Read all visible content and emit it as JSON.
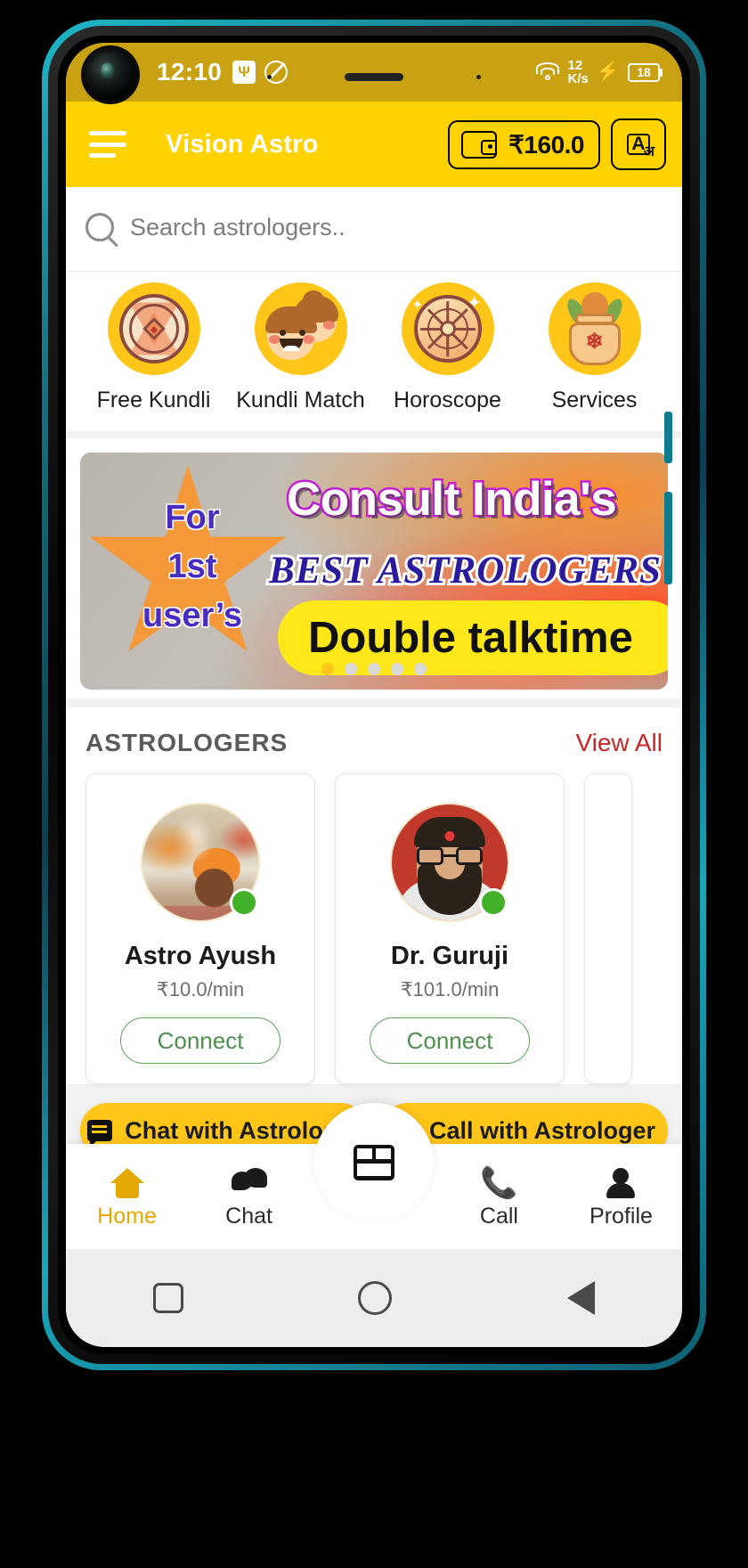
{
  "status_bar": {
    "time": "12:10",
    "usb_icon": "usb-icon",
    "mute_icon": "mute-icon",
    "wifi_icon": "wifi-icon",
    "net_speed_value": "12",
    "net_speed_unit": "K/s",
    "charging_icon": "lightning-bolt-icon",
    "battery_level": "18"
  },
  "app_bar": {
    "menu_icon": "hamburger-menu-icon",
    "title": "Vision Astro",
    "wallet_icon": "wallet-icon",
    "wallet_balance": "₹160.0",
    "language_icon": "language-translate-icon",
    "background_color": "#FFD200"
  },
  "search": {
    "icon": "search-icon",
    "placeholder": "Search astrologers..",
    "value": ""
  },
  "categories": [
    {
      "label": "Free Kundli",
      "icon": "kundli-chart-icon"
    },
    {
      "label": "Kundli Match",
      "icon": "couple-faces-icon"
    },
    {
      "label": "Horoscope",
      "icon": "zodiac-wheel-icon"
    },
    {
      "label": "Services",
      "icon": "kalash-pot-icon"
    }
  ],
  "banner": {
    "star_text": "For\n1st\nuser’s",
    "star_line1": "For",
    "star_line2": "1st",
    "star_line3": "user’s",
    "headline": "Consult India's",
    "subhead": "BEST ASTROLOGERS",
    "offer": "Double talktime",
    "dots_total": 5,
    "dots_active_index": 0,
    "headline_color": "#C21ED6",
    "subhead_color": "#2A1B9E",
    "offer_bg": "#FFE81A"
  },
  "astrologers_section": {
    "title": "ASTROLOGERS",
    "view_all": "View All",
    "view_all_color": "#C62828",
    "cards": [
      {
        "name": "Astro Ayush",
        "price": "₹10.0/min",
        "connect_label": "Connect",
        "online": true,
        "avatar": "astrologer-photo"
      },
      {
        "name": "Dr. Guruji",
        "price": "₹101.0/min",
        "connect_label": "Connect",
        "online": true,
        "avatar": "astrologer-photo"
      }
    ]
  },
  "cta": {
    "chat_label": "Chat with Astrologer",
    "chat_icon": "chat-bubble-icon",
    "call_label": "Call with Astrologer",
    "call_icon": "phone-icon",
    "background_color": "#FFC61A"
  },
  "bottom_nav": {
    "items": [
      {
        "label": "Home",
        "icon": "home-icon",
        "active": true
      },
      {
        "label": "Chat",
        "icon": "chat-icon",
        "active": false
      },
      {
        "label": "Call",
        "icon": "phone-icon",
        "active": false
      },
      {
        "label": "Profile",
        "icon": "person-icon",
        "active": false
      }
    ],
    "center_fab_icon": "live-video-icon",
    "active_color": "#E3A900"
  },
  "system_nav": {
    "recents_icon": "square-recents-icon",
    "home_icon": "circle-home-icon",
    "back_icon": "triangle-back-icon"
  }
}
